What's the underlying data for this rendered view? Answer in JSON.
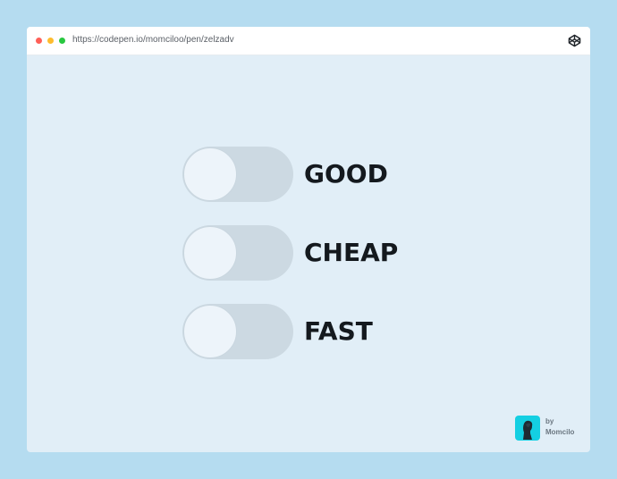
{
  "browser": {
    "url": "https://codepen.io/momciloo/pen/zelzadv",
    "icon": "codepen-icon"
  },
  "toggles": [
    {
      "label": "GOOD",
      "on": false
    },
    {
      "label": "CHEAP",
      "on": false
    },
    {
      "label": "FAST",
      "on": false
    }
  ],
  "credit": {
    "by": "by",
    "author": "Momcilo"
  },
  "colors": {
    "page_background": "#b5dcf0",
    "canvas_background": "#e1eef7",
    "track_off": "#ccd9e2",
    "knob": "#edf4fa",
    "label_text": "#14191e",
    "avatar_background": "#14cfe2"
  }
}
